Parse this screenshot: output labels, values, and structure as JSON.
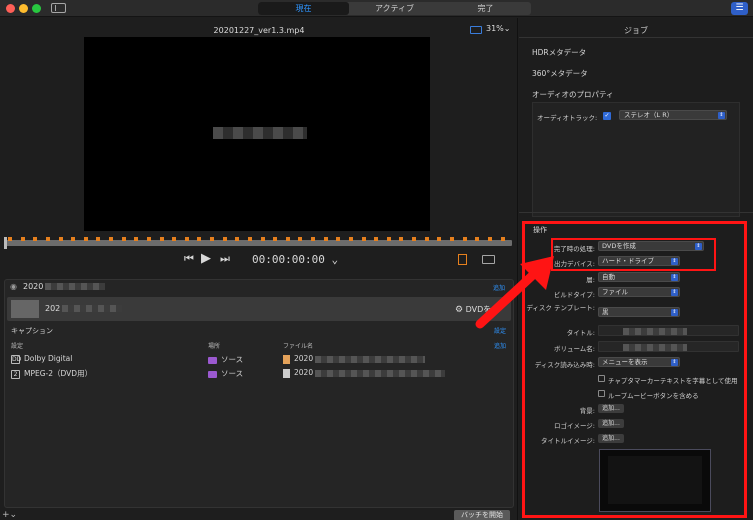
{
  "titlebar": {
    "tabs": [
      {
        "label": "現在",
        "active": true
      },
      {
        "label": "アクティブ",
        "active": false
      },
      {
        "label": "完了",
        "active": false
      }
    ],
    "traffic_colors": [
      "#ff5f57",
      "#febc2e",
      "#28c840"
    ],
    "accent": "#2f95ff"
  },
  "viewer": {
    "file_title": "20201227_ver1.3.mp4",
    "zoom": "31%",
    "zoom_chevron": "⌄",
    "timecode": "00:00:00:00",
    "timecode_chevron": "⌄",
    "marker_color": "#e6801e",
    "marker_count": 40
  },
  "batch": {
    "name_prefix": "2020",
    "add_label": "追加",
    "job": {
      "name_prefix": "202",
      "destination": "DVD",
      "destination_suffix": "を"
    },
    "caption_label": "キャプション",
    "caption_edit": "設定",
    "columns": [
      "設定",
      "場所",
      "ファイル名"
    ],
    "columns_add": "追加",
    "rows": [
      {
        "icon": "DD",
        "setting": "Dolby Digital",
        "location": "ソース",
        "file_prefix": "2020"
      },
      {
        "icon": "2",
        "setting": "MPEG-2（DVD用）",
        "location": "ソース",
        "file_prefix": "2020"
      }
    ],
    "footer_plus": "+⌄",
    "start_button": "バッチを開始"
  },
  "inspector": {
    "header": "ジョブ",
    "sections": [
      "HDRメタデータ",
      "360°メタデータ",
      "オーディオのプロパティ"
    ],
    "audio_track_label": "オーディオトラック:",
    "audio_track_checkmark": "✓",
    "audio_track_value": "ステレオ（L R）",
    "operation_title": "操作",
    "fields": [
      {
        "label": "完了時の処理:",
        "value": "DVDを作成",
        "type": "select"
      },
      {
        "label": "出力デバイス:",
        "value": "ハード・ドライブ",
        "type": "select"
      },
      {
        "label": "層:",
        "value": "自動",
        "type": "select"
      },
      {
        "label": "ビルドタイプ:",
        "value": "ファイル",
        "type": "select"
      },
      {
        "label": "ディスク テンプレート:",
        "value": "黒",
        "type": "select"
      },
      {
        "label": "タイトル:",
        "value": "",
        "type": "text"
      },
      {
        "label": "ボリューム名:",
        "value": "",
        "type": "text"
      },
      {
        "label": "ディスク読み込み時:",
        "value": "メニューを表示",
        "type": "select"
      }
    ],
    "checkboxes": [
      "チャプタマーカーテキストを字幕として使用",
      "ループムービーボタンを含める"
    ],
    "add_fields": [
      {
        "label": "背景:",
        "button": "追加..."
      },
      {
        "label": "ロゴイメージ:",
        "button": "追加..."
      },
      {
        "label": "タイトルイメージ:",
        "button": "追加..."
      }
    ]
  },
  "annotation": {
    "color": "#ff1414"
  }
}
